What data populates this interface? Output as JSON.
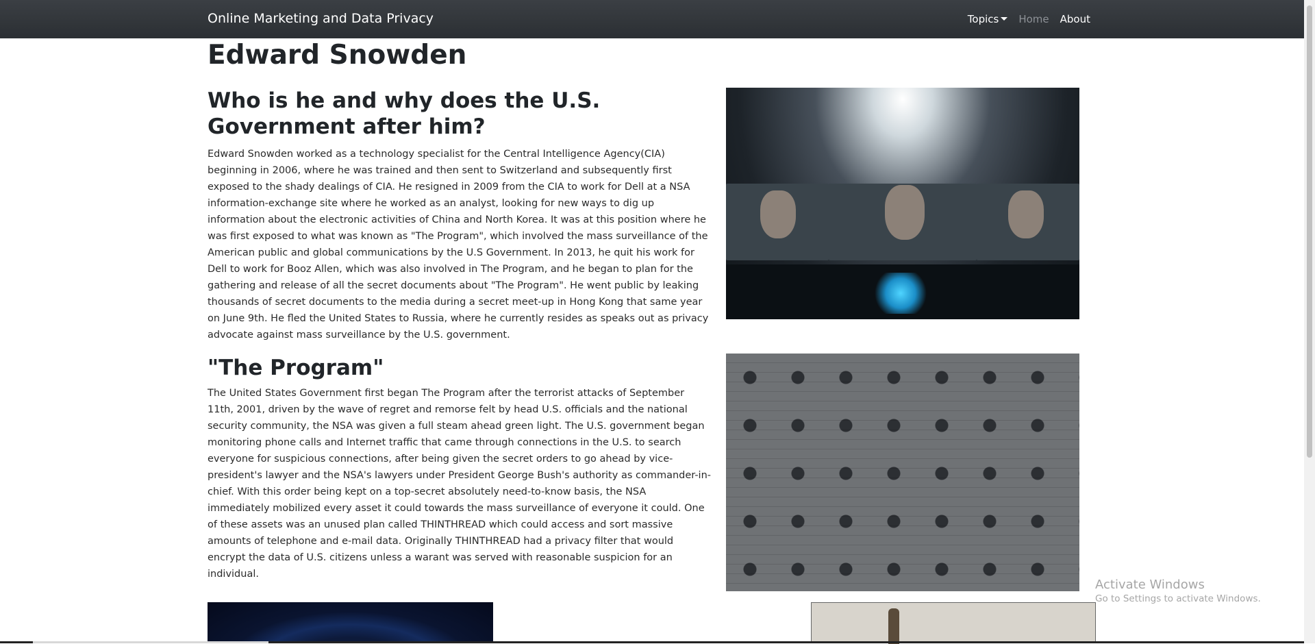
{
  "navbar": {
    "brand": "Online Marketing and Data Privacy",
    "links": [
      {
        "label": "Topics",
        "dropdown": true,
        "active": false
      },
      {
        "label": "Home",
        "dropdown": false,
        "active": true
      },
      {
        "label": "About",
        "dropdown": false,
        "active": false
      }
    ]
  },
  "page": {
    "title": "Edward Snowden"
  },
  "sections": [
    {
      "heading": "Who is he and why does the U.S. Government after him?",
      "body": "Edward Snowden worked as a technology specialist for the Central Intelligence Agency(CIA) beginning in 2006, where he was trained and then sent to Switzerland and subsequently first exposed to the shady dealings of CIA. He resigned in 2009 from the CIA to work for Dell at a NSA information-exchange site where he worked as an analyst, looking for new ways to dig up information about the electronic activities of China and North Korea. It was at this position where he was first exposed to what was known as \"The Program\", which involved the mass surveillance of the American public and global communications by the U.S Government. In 2013, he quit his work for Dell to work for Booz Allen, which was also involved in The Program, and he began to plan for the gathering and release of all the secret documents about \"The Program\". He went public by leaking thousands of secret documents to the media during a secret meet-up in Hong Kong that same year on June 9th. He fled the United States to Russia, where he currently resides as speaks out as privacy advocate against mass surveillance by the U.S. government."
    },
    {
      "heading": "\"The Program\"",
      "body": "The United States Government first began The Program after the terrorist attacks of September 11th, 2001, driven by the wave of regret and remorse felt by head U.S. officials and the national security community, the NSA was given a full steam ahead green light. The U.S. government began monitoring phone calls and Internet traffic that came through connections in the U.S. to search everyone for suspicious connections, after being given the secret orders to go ahead by vice-president's lawyer and the NSA's lawyers under President George Bush's authority as commander-in-chief. With this order being kept on a top-secret absolutely need-to-know basis, the NSA immediately mobilized every asset it could towards the mass surveillance of everyone it could. One of these assets was an unused plan called THINTHREAD which could access and sort massive amounts of telephone and e-mail data. Originally THINTHREAD had a privacy filter that would encrypt the data of U.S. citizens unless a warant was served with reasonable suspicion for an individual."
    }
  ],
  "watermark": {
    "title": "Activate Windows",
    "subtitle": "Go to Settings to activate Windows."
  },
  "colors": {
    "navbar": "#343a40",
    "active_link": "#8d9196",
    "text": "#212529"
  }
}
